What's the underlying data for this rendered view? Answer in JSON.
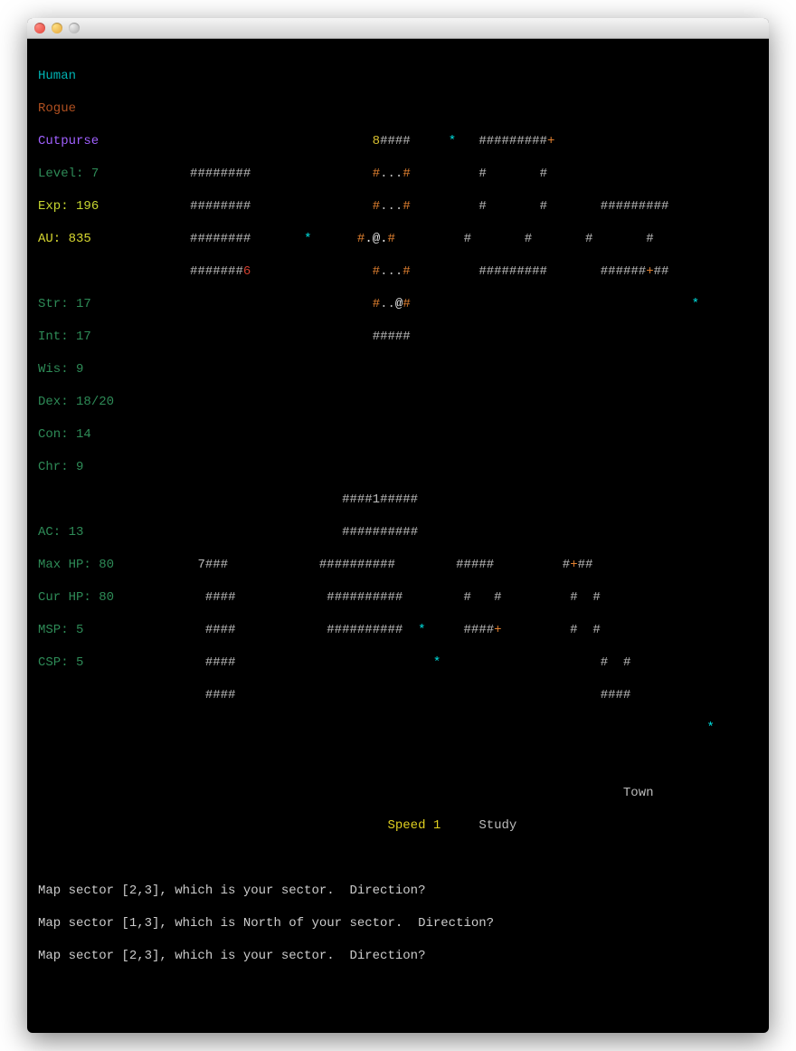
{
  "character": {
    "race": "Human",
    "class": "Rogue",
    "title": "Cutpurse",
    "level_label": "Level: ",
    "level": "7",
    "exp_label": "Exp: ",
    "exp": "196",
    "au_label": "AU: ",
    "au": "835",
    "str_label": "Str: ",
    "str": "17",
    "int_label": "Int: ",
    "int": "17",
    "wis_label": "Wis: ",
    "wis": "9",
    "dex_label": "Dex: ",
    "dex": "18/20",
    "con_label": "Con: ",
    "con": "14",
    "chr_label": "Chr: ",
    "chr": "9",
    "ac_label": "AC: ",
    "ac": "13",
    "maxhp_label": "Max HP: ",
    "maxhp": "80",
    "curhp_label": "Cur HP: ",
    "curhp": "80",
    "msp_label": "MSP: ",
    "msp": "5",
    "csp_label": "CSP: ",
    "csp": "5"
  },
  "map": {
    "r0_8": "8",
    "r0_wall1": "####",
    "r0_star": "*",
    "r0_wall2": "#########",
    "r0_plus": "+",
    "r1_wall1": "########",
    "r1_o1": "#",
    "r1_dots": "...",
    "r1_o2": "#",
    "r1_wall2": "#",
    "r1_wall3": "#",
    "r2_wall1": "########",
    "r2_o1": "#",
    "r2_dots": "...",
    "r2_o2": "#",
    "r2_wall2": "#",
    "r2_wall3": "#",
    "r2_wall4": "#########",
    "r3_wall1": "########",
    "r3_star": "*",
    "r3_o1": "#",
    "r3_at": ".@.",
    "r3_o2": "#",
    "r3_wall2": "#",
    "r3_wall3": "#",
    "r3_wall4": "#",
    "r3_wall5": "#",
    "r4_wall1": "#######",
    "r4_6": "6",
    "r4_o1": "#",
    "r4_dots": "...",
    "r4_o2": "#",
    "r4_wall2": "#########",
    "r4_wall3": "######",
    "r4_plus": "+",
    "r4_wall4": "##",
    "r5_o1": "#",
    "r5_dots": "..",
    "r5_at": "@",
    "r5_o2": "#",
    "r5_star": "*",
    "r6_wall1": "#####",
    "r7_wall1": "####",
    "r7_1": "1",
    "r7_wall2": "#####",
    "r8_wall1": "##########",
    "r9_7": "7",
    "r9_wall1": "###",
    "r9_wall2": "##########",
    "r9_wall3": "#####",
    "r9_wall4": "#",
    "r9_plus": "+",
    "r9_wall5": "##",
    "r10_wall1": "####",
    "r10_wall2": "##########",
    "r10_wall3": "#",
    "r10_wall4": "#",
    "r10_wall5": "#",
    "r10_wall6": "#",
    "r11_wall1": "####",
    "r11_wall2": "##########",
    "r11_star1": "*",
    "r11_wall3": "####",
    "r11_plus": "+",
    "r11_wall4": "#",
    "r11_wall5": "#",
    "r12_wall1": "####",
    "r12_star": "*",
    "r12_wall2": "#",
    "r12_wall3": "#",
    "r13_wall1": "####",
    "r13_wall2": "####",
    "r14_star": "*"
  },
  "location": "Town",
  "status": {
    "speed_label": "Speed ",
    "speed_val": "1",
    "study": "Study"
  },
  "log": {
    "l1": "Map sector [2,3], which is your sector.  Direction?",
    "l2": "Map sector [1,3], which is North of your sector.  Direction?",
    "l3": "Map sector [2,3], which is your sector.  Direction?"
  }
}
